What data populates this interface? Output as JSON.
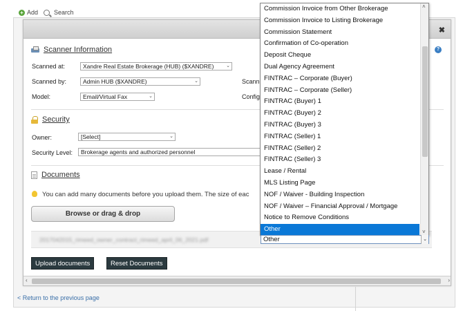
{
  "toolbar": {
    "add_label": "Add",
    "search_label": "Search"
  },
  "scanner": {
    "title": "Scanner Information",
    "scanned_at_label": "Scanned at:",
    "scanned_at_value": "Xandre Real Estate Brokerage (HUB) ($XANDRE)",
    "scanned_by_label": "Scanned by:",
    "scanned_by_value": "Admin HUB ($XANDRE)",
    "model_label": "Model:",
    "model_value": "Email/Virtual Fax",
    "scan_partial_label": "Scann",
    "config_partial_label": "Config",
    "side_partial_text": "e"
  },
  "security": {
    "title": "Security",
    "owner_label": "Owner:",
    "owner_value": "[Select]",
    "level_label": "Security Level:",
    "level_value": "Brokerage agents and authorized personnel"
  },
  "documents": {
    "title": "Documents",
    "info_text": "You can add many documents before you upload them. The size of eac",
    "browse_label": "Browse or drag & drop",
    "file_name": "2017042015_rimeed_owner_contract_rimeed_april_06_2021.pdf",
    "doc_type_value": "Other"
  },
  "buttons": {
    "upload": "Upload documents",
    "reset": "Reset Documents"
  },
  "back_link": "< Return to the previous page",
  "dropdown": {
    "options": [
      "Commission Invoice from Other Brokerage",
      "Commission Invoice to Listing Brokerage",
      "Commission Statement",
      "Confirmation of Co-operation",
      "Deposit Cheque",
      "Dual Agency Agreement",
      "FINTRAC – Corporate (Buyer)",
      "FINTRAC – Corporate (Seller)",
      "FINTRAC (Buyer) 1",
      "FINTRAC (Buyer) 2",
      "FINTRAC (Buyer) 3",
      "FINTRAC (Seller) 1",
      "FINTRAC (Seller) 2",
      "FINTRAC (Seller) 3",
      "Lease / Rental",
      "MLS Listing Page",
      "NOF / Waiver - Building Inspection",
      "NOF / Waiver – Financial Approval / Mortgage",
      "Notice to Remove Conditions",
      "Other"
    ],
    "selected": "Other"
  },
  "colors": {
    "accent": "#0a78d7",
    "dark_button": "#2b3a3f",
    "link": "#3a6fa8"
  }
}
